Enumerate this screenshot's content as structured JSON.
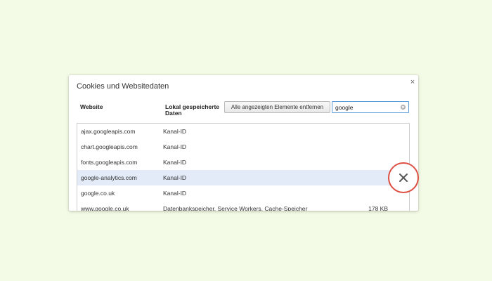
{
  "dialog": {
    "title": "Cookies und Websitedaten",
    "close_label": "×",
    "columns": {
      "website": "Website",
      "local_data": "Lokal gespeicherte Daten"
    },
    "remove_all_label": "Alle angezeigten Elemente entfernen",
    "search": {
      "value": "google",
      "placeholder": ""
    },
    "rows": [
      {
        "site": "ajax.googleapis.com",
        "kind": "Kanal-ID",
        "size": ""
      },
      {
        "site": "chart.googleapis.com",
        "kind": "Kanal-ID",
        "size": ""
      },
      {
        "site": "fonts.googleapis.com",
        "kind": "Kanal-ID",
        "size": ""
      },
      {
        "site": "google-analytics.com",
        "kind": "Kanal-ID",
        "size": ""
      },
      {
        "site": "google.co.uk",
        "kind": "Kanal-ID",
        "size": ""
      },
      {
        "site": "www.google.co.uk",
        "kind": "Datenbankspeicher, Service Workers, Cache-Speicher",
        "size": "178 KB"
      }
    ],
    "selected_row_index": 3
  },
  "colors": {
    "page_background": "#f3fbe6",
    "selected_row": "#e3ebf8",
    "highlight_ring": "#dd4e43",
    "search_focus_border": "#5b9bd5"
  },
  "icons": {
    "row_remove": "remove-x-icon",
    "search_clear": "clear-circle-icon"
  }
}
